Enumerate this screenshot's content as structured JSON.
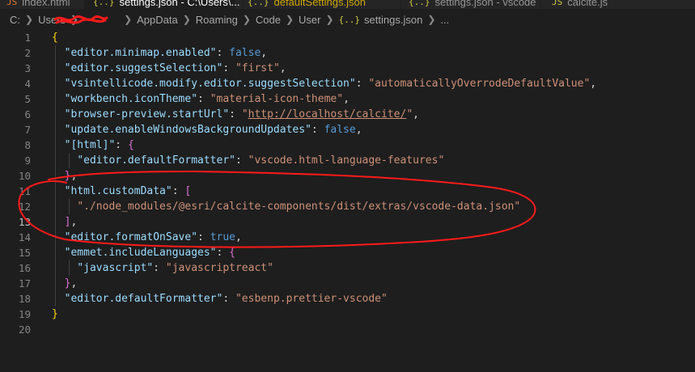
{
  "tabs": [
    {
      "icon": "JS",
      "label": "index.html"
    },
    {
      "icon": "{..}",
      "label": "settings.json - C:\\Users\\...",
      "active": true
    },
    {
      "icon": "{..}",
      "label": "defaultSettings.json"
    },
    {
      "icon": "{..}",
      "label": "settings.json - vscode"
    },
    {
      "icon": "JS",
      "label": "calcite.js"
    }
  ],
  "breadcrumb": [
    "C:",
    "Users",
    "",
    "AppData",
    "Roaming",
    "Code",
    "User"
  ],
  "breadcrumb_file": "settings.json",
  "breadcrumb_file_icon": "{..}",
  "breadcrumb_more": "...",
  "editor": {
    "lines": [
      "1",
      "2",
      "3",
      "4",
      "5",
      "6",
      "7",
      "8",
      "9",
      "10",
      "11",
      "12",
      "13",
      "14",
      "15",
      "16",
      "17",
      "18",
      "19",
      "20"
    ],
    "current_line": "13",
    "code": {
      "l1": "{",
      "l2_key": "\"editor.minimap.enabled\"",
      "l2_val": "false",
      "l3_key": "\"editor.suggestSelection\"",
      "l3_val": "\"first\"",
      "l4_key": "\"vsintellicode.modify.editor.suggestSelection\"",
      "l4_val": "\"automaticallyOverrodeDefaultValue\"",
      "l5_key": "\"workbench.iconTheme\"",
      "l5_val": "\"material-icon-theme\"",
      "l6_key": "\"browser-preview.startUrl\"",
      "l6_val": "http://localhost/calcite/",
      "l7_key": "\"update.enableWindowsBackgroundUpdates\"",
      "l7_val": "false",
      "l8_key": "\"[html]\"",
      "l9_key": "\"editor.defaultFormatter\"",
      "l9_val": "\"vscode.html-language-features\"",
      "l11_key": "\"html.customData\"",
      "l12_val": "\"./node_modules/@esri/calcite-components/dist/extras/vscode-data.json\"",
      "l14_key": "\"editor.formatOnSave\"",
      "l14_val": "true",
      "l15_key": "\"emmet.includeLanguages\"",
      "l16_key": "\"javascript\"",
      "l16_val": "\"javascriptreact\"",
      "l18_key": "\"editor.defaultFormatter\"",
      "l18_val": "\"esbenp.prettier-vscode\""
    }
  },
  "colors": {
    "background": "#1e1e1e",
    "key": "#9cdcfe",
    "string": "#ce9178",
    "boolean": "#569cd6",
    "bracket": "#ffd700",
    "annotation": "#ff1a1a"
  }
}
